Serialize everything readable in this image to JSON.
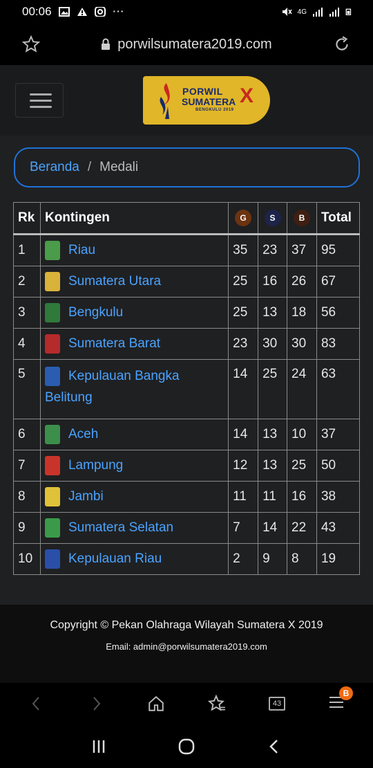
{
  "status_bar": {
    "time": "00:06",
    "network": "4G"
  },
  "browser": {
    "url": "porwilsumatera2019.com",
    "tab_count": "43",
    "menu_badge": "B"
  },
  "logo": {
    "line1": "PORWIL",
    "line2": "SUMATERA",
    "line3": "BENGKULU 2019",
    "mark": "X"
  },
  "breadcrumb": {
    "home": "Beranda",
    "separator": "/",
    "current": "Medali"
  },
  "table": {
    "headers": {
      "rank": "Rk",
      "contingent": "Kontingen",
      "gold": "G",
      "silver": "S",
      "bronze": "B",
      "total": "Total"
    },
    "colors": {
      "gold": "#6b3410",
      "silver": "#1d2449",
      "bronze": "#3e1f12",
      "link": "#4aa3ff"
    },
    "rows": [
      {
        "rank": "1",
        "name": "Riau",
        "gold": "35",
        "silver": "23",
        "bronze": "37",
        "total": "95",
        "emblem": "#4a9b4a"
      },
      {
        "rank": "2",
        "name": "Sumatera Utara",
        "gold": "25",
        "silver": "16",
        "bronze": "26",
        "total": "67",
        "emblem": "#d9b23a"
      },
      {
        "rank": "3",
        "name": "Bengkulu",
        "gold": "25",
        "silver": "13",
        "bronze": "18",
        "total": "56",
        "emblem": "#2f7a3a"
      },
      {
        "rank": "4",
        "name": "Sumatera Barat",
        "gold": "23",
        "silver": "30",
        "bronze": "30",
        "total": "83",
        "emblem": "#b52a2a"
      },
      {
        "rank": "5",
        "name": "Kepulauan Bangka",
        "name2": "Belitung",
        "gold": "14",
        "silver": "25",
        "bronze": "24",
        "total": "63",
        "emblem": "#2a5db0"
      },
      {
        "rank": "6",
        "name": "Aceh",
        "gold": "14",
        "silver": "13",
        "bronze": "10",
        "total": "37",
        "emblem": "#3c8f4a"
      },
      {
        "rank": "7",
        "name": "Lampung",
        "gold": "12",
        "silver": "13",
        "bronze": "25",
        "total": "50",
        "emblem": "#c9342a"
      },
      {
        "rank": "8",
        "name": "Jambi",
        "gold": "11",
        "silver": "11",
        "bronze": "16",
        "total": "38",
        "emblem": "#e0c23a"
      },
      {
        "rank": "9",
        "name": "Sumatera Selatan",
        "gold": "7",
        "silver": "14",
        "bronze": "22",
        "total": "43",
        "emblem": "#3a9a4a"
      },
      {
        "rank": "10",
        "name": "Kepulauan Riau",
        "gold": "2",
        "silver": "9",
        "bronze": "8",
        "total": "19",
        "emblem": "#2a4fa8"
      }
    ]
  },
  "footer": {
    "copyright": "Copyright © Pekan Olahraga Wilayah Sumatera X 2019",
    "email": "Email: admin@porwilsumatera2019.com"
  }
}
